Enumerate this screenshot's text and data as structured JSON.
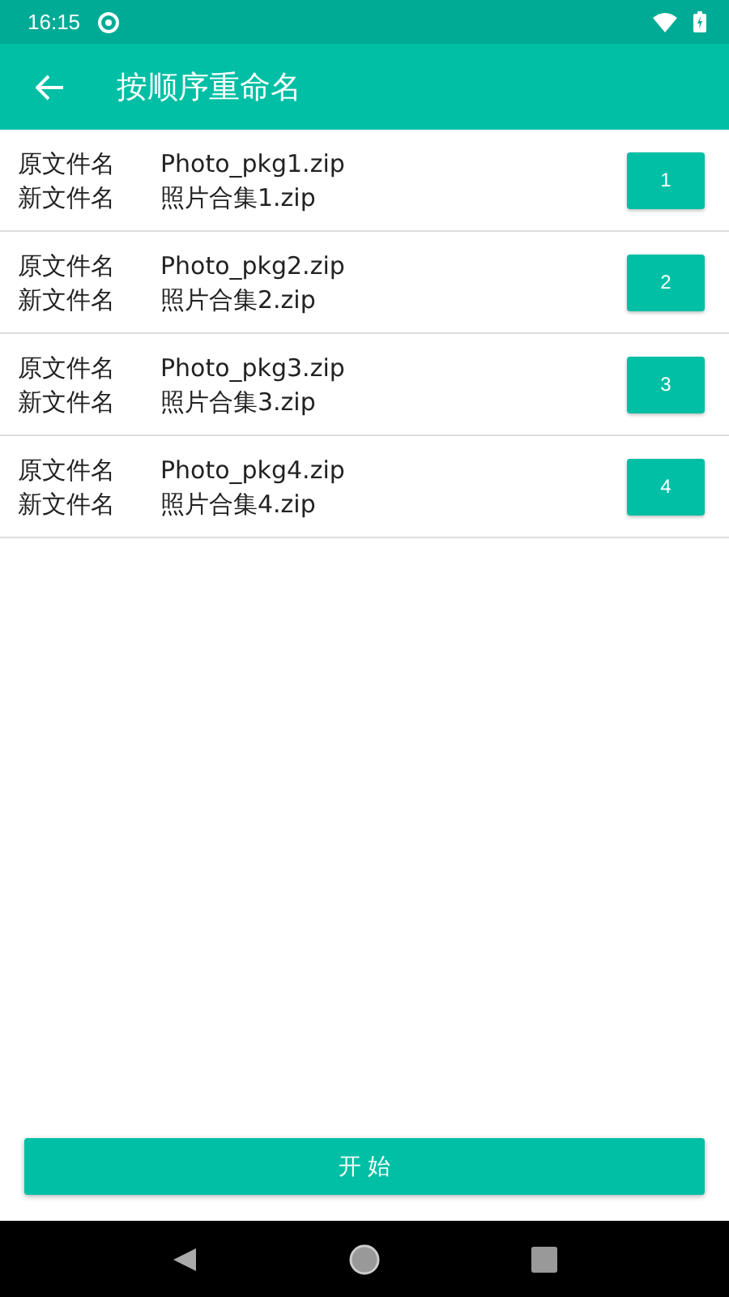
{
  "status_bar": {
    "time": "16:15"
  },
  "app_bar": {
    "title": "按顺序重命名"
  },
  "files": [
    {
      "old_label": "原文件名",
      "old_name": "Photo_pkg1.zip",
      "new_label": "新文件名",
      "new_name": "照片合集1.zip",
      "index": "1"
    },
    {
      "old_label": "原文件名",
      "old_name": "Photo_pkg2.zip",
      "new_label": "新文件名",
      "new_name": "照片合集2.zip",
      "index": "2"
    },
    {
      "old_label": "原文件名",
      "old_name": "Photo_pkg3.zip",
      "new_label": "新文件名",
      "new_name": "照片合集3.zip",
      "index": "3"
    },
    {
      "old_label": "原文件名",
      "old_name": "Photo_pkg4.zip",
      "new_label": "新文件名",
      "new_name": "照片合集4.zip",
      "index": "4"
    }
  ],
  "start_button": "开 始"
}
